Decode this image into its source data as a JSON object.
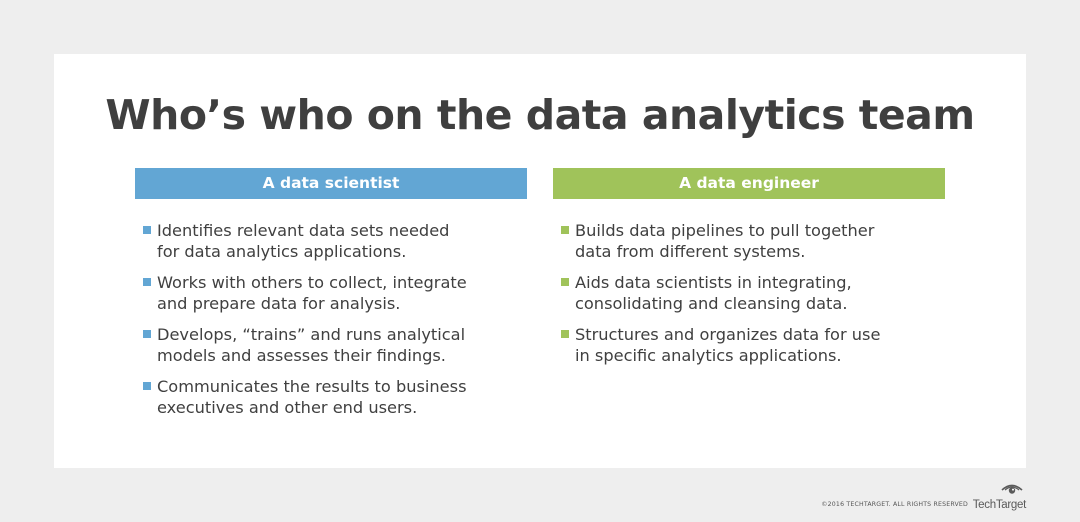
{
  "title": "Who’s who on the data analytics team",
  "colors": {
    "background": "#eeeeee",
    "card": "#ffffff",
    "scientist_accent": "#62a6d4",
    "engineer_accent": "#a0c35a",
    "text": "#404040"
  },
  "columns": [
    {
      "header": "A data scientist",
      "items": [
        {
          "line1": "Identifies relevant data sets needed",
          "line2": "for data analytics applications."
        },
        {
          "line1": "Works with others to collect, integrate",
          "line2": "and prepare data for analysis."
        },
        {
          "line1": "Develops, “trains” and runs analytical",
          "line2": "models and assesses their findings."
        },
        {
          "line1": "Communicates the results to business",
          "line2": "executives and other end users."
        }
      ]
    },
    {
      "header": "A data engineer",
      "items": [
        {
          "line1": "Builds data pipelines to pull together",
          "line2": "data from different systems."
        },
        {
          "line1": "Aids data scientists in integrating,",
          "line2": "consolidating and cleansing data."
        },
        {
          "line1": "Structures and organizes data for use",
          "line2": "in specific analytics applications."
        }
      ]
    }
  ],
  "footer": {
    "copyright": "©2016 TECHTARGET. ALL RIGHTS RESERVED",
    "brand": "TechTarget",
    "brand_icon": "eye-logo-icon"
  }
}
